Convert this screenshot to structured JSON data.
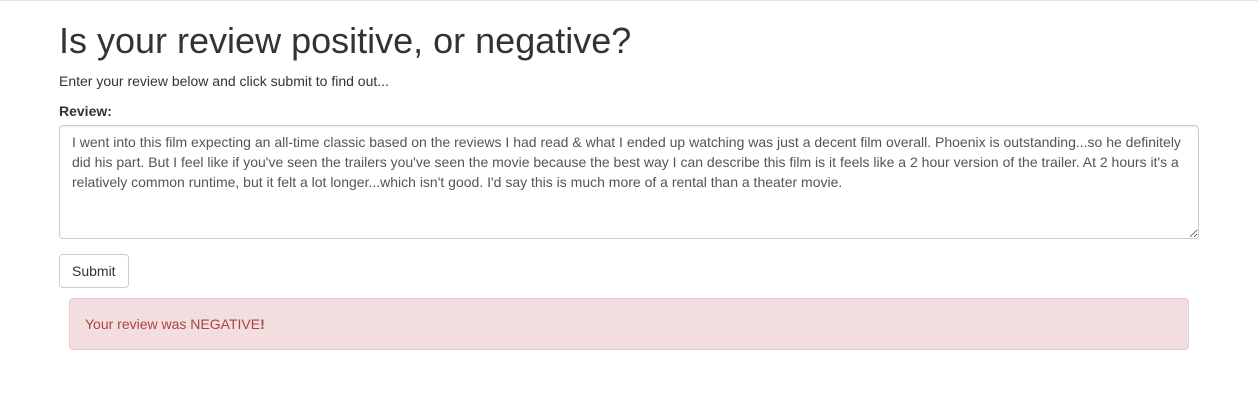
{
  "page": {
    "heading": "Is your review positive, or negative?",
    "subtitle": "Enter your review below and click submit to find out..."
  },
  "form": {
    "review_label": "Review:",
    "review_value": "I went into this film expecting an all-time classic based on the reviews I had read & what I ended up watching was just a decent film overall. Phoenix is outstanding...so he definitely did his part. But I feel like if you've seen the trailers you've seen the movie because the best way I can describe this film is it feels like a 2 hour version of the trailer. At 2 hours it's a relatively common runtime, but it felt a lot longer...which isn't good. I'd say this is much more of a rental than a theater movie.",
    "submit_label": "Submit"
  },
  "result": {
    "message": "Your review was NEGATIVE",
    "suffix": "!",
    "colors": {
      "background": "#f2dede",
      "border": "#ebccd1",
      "text": "#a94442"
    }
  }
}
